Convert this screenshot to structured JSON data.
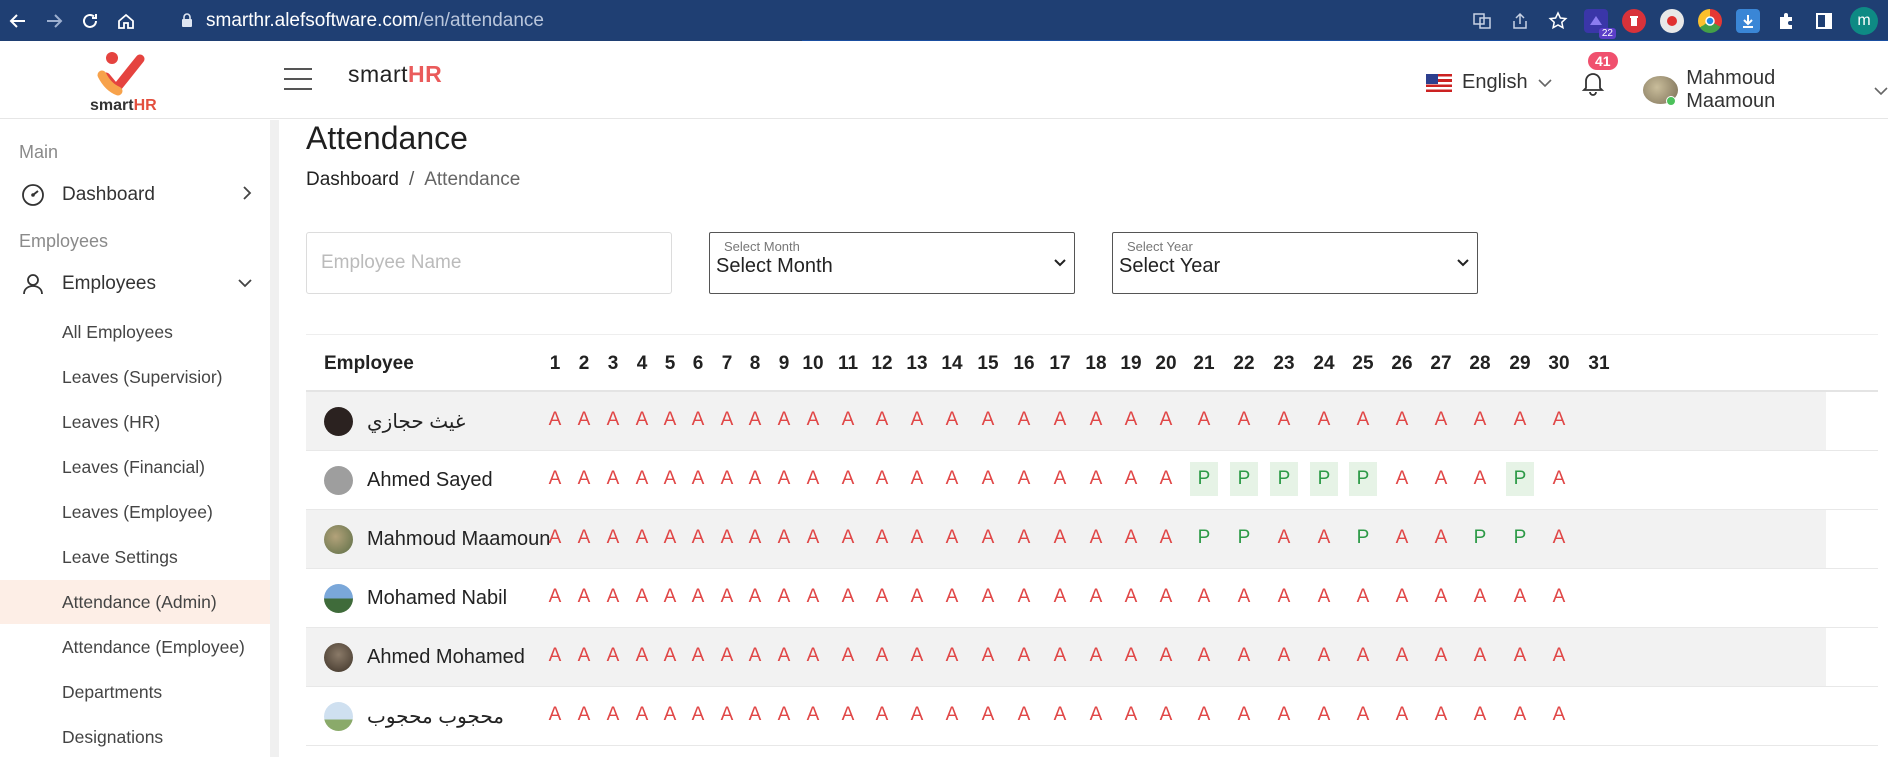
{
  "browser": {
    "url_host": "smarthr.alefsoftware.com",
    "url_path": "/en/attendance",
    "ext_badge": "22",
    "profile_initial": "m"
  },
  "header": {
    "logo_text_a": "smart",
    "logo_text_b": "HR",
    "brand_a": "smart",
    "brand_b": "HR",
    "language": "English",
    "notifications_count": "41",
    "user_name": "Mahmoud Maamoun"
  },
  "sidebar": {
    "section_main": "Main",
    "dashboard": "Dashboard",
    "section_employees": "Employees",
    "employees": "Employees",
    "sub_items": [
      "All Employees",
      "Leaves (Supervisior)",
      "Leaves (HR)",
      "Leaves (Financial)",
      "Leaves (Employee)",
      "Leave Settings",
      "Attendance (Admin)",
      "Attendance (Employee)",
      "Departments",
      "Designations"
    ]
  },
  "page": {
    "title": "Attendance",
    "breadcrumb_home": "Dashboard",
    "breadcrumb_sep": "/",
    "breadcrumb_current": "Attendance"
  },
  "filters": {
    "name_placeholder": "Employee Name",
    "month_label": "Select Month",
    "month_value": "Select Month",
    "year_label": "Select Year",
    "year_value": "Select Year"
  },
  "table": {
    "employee_header": "Employee",
    "days": [
      "1",
      "2",
      "3",
      "4",
      "5",
      "6",
      "7",
      "8",
      "9",
      "10",
      "11",
      "12",
      "13",
      "14",
      "15",
      "16",
      "17",
      "18",
      "19",
      "20",
      "21",
      "22",
      "23",
      "24",
      "25",
      "26",
      "27",
      "28",
      "29",
      "30",
      "31"
    ],
    "rows": [
      {
        "name": "غيث حجازي",
        "marks": [
          "A",
          "A",
          "A",
          "A",
          "A",
          "A",
          "A",
          "A",
          "A",
          "A",
          "A",
          "A",
          "A",
          "A",
          "A",
          "A",
          "A",
          "A",
          "A",
          "A",
          "A",
          "A",
          "A",
          "A",
          "A",
          "A",
          "A",
          "A",
          "A",
          "A"
        ]
      },
      {
        "name": "Ahmed Sayed",
        "marks": [
          "A",
          "A",
          "A",
          "A",
          "A",
          "A",
          "A",
          "A",
          "A",
          "A",
          "A",
          "A",
          "A",
          "A",
          "A",
          "A",
          "A",
          "A",
          "A",
          "A",
          "P",
          "P",
          "P",
          "P",
          "P",
          "A",
          "A",
          "A",
          "P",
          "A"
        ]
      },
      {
        "name": "Mahmoud Maamoun",
        "marks": [
          "A",
          "A",
          "A",
          "A",
          "A",
          "A",
          "A",
          "A",
          "A",
          "A",
          "A",
          "A",
          "A",
          "A",
          "A",
          "A",
          "A",
          "A",
          "A",
          "A",
          "P",
          "P",
          "A",
          "A",
          "P",
          "A",
          "A",
          "P",
          "P",
          "A"
        ]
      },
      {
        "name": "Mohamed Nabil",
        "marks": [
          "A",
          "A",
          "A",
          "A",
          "A",
          "A",
          "A",
          "A",
          "A",
          "A",
          "A",
          "A",
          "A",
          "A",
          "A",
          "A",
          "A",
          "A",
          "A",
          "A",
          "A",
          "A",
          "A",
          "A",
          "A",
          "A",
          "A",
          "A",
          "A",
          "A"
        ]
      },
      {
        "name": "Ahmed Mohamed",
        "marks": [
          "A",
          "A",
          "A",
          "A",
          "A",
          "A",
          "A",
          "A",
          "A",
          "A",
          "A",
          "A",
          "A",
          "A",
          "A",
          "A",
          "A",
          "A",
          "A",
          "A",
          "A",
          "A",
          "A",
          "A",
          "A",
          "A",
          "A",
          "A",
          "A",
          "A"
        ]
      },
      {
        "name": "محجوب محجوب",
        "marks": [
          "A",
          "A",
          "A",
          "A",
          "A",
          "A",
          "A",
          "A",
          "A",
          "A",
          "A",
          "A",
          "A",
          "A",
          "A",
          "A",
          "A",
          "A",
          "A",
          "A",
          "A",
          "A",
          "A",
          "A",
          "A",
          "A",
          "A",
          "A",
          "A",
          "A"
        ]
      }
    ]
  },
  "colors": {
    "absent": "#e04646",
    "present": "#2d9a47",
    "accent": "#ea5b5b"
  }
}
